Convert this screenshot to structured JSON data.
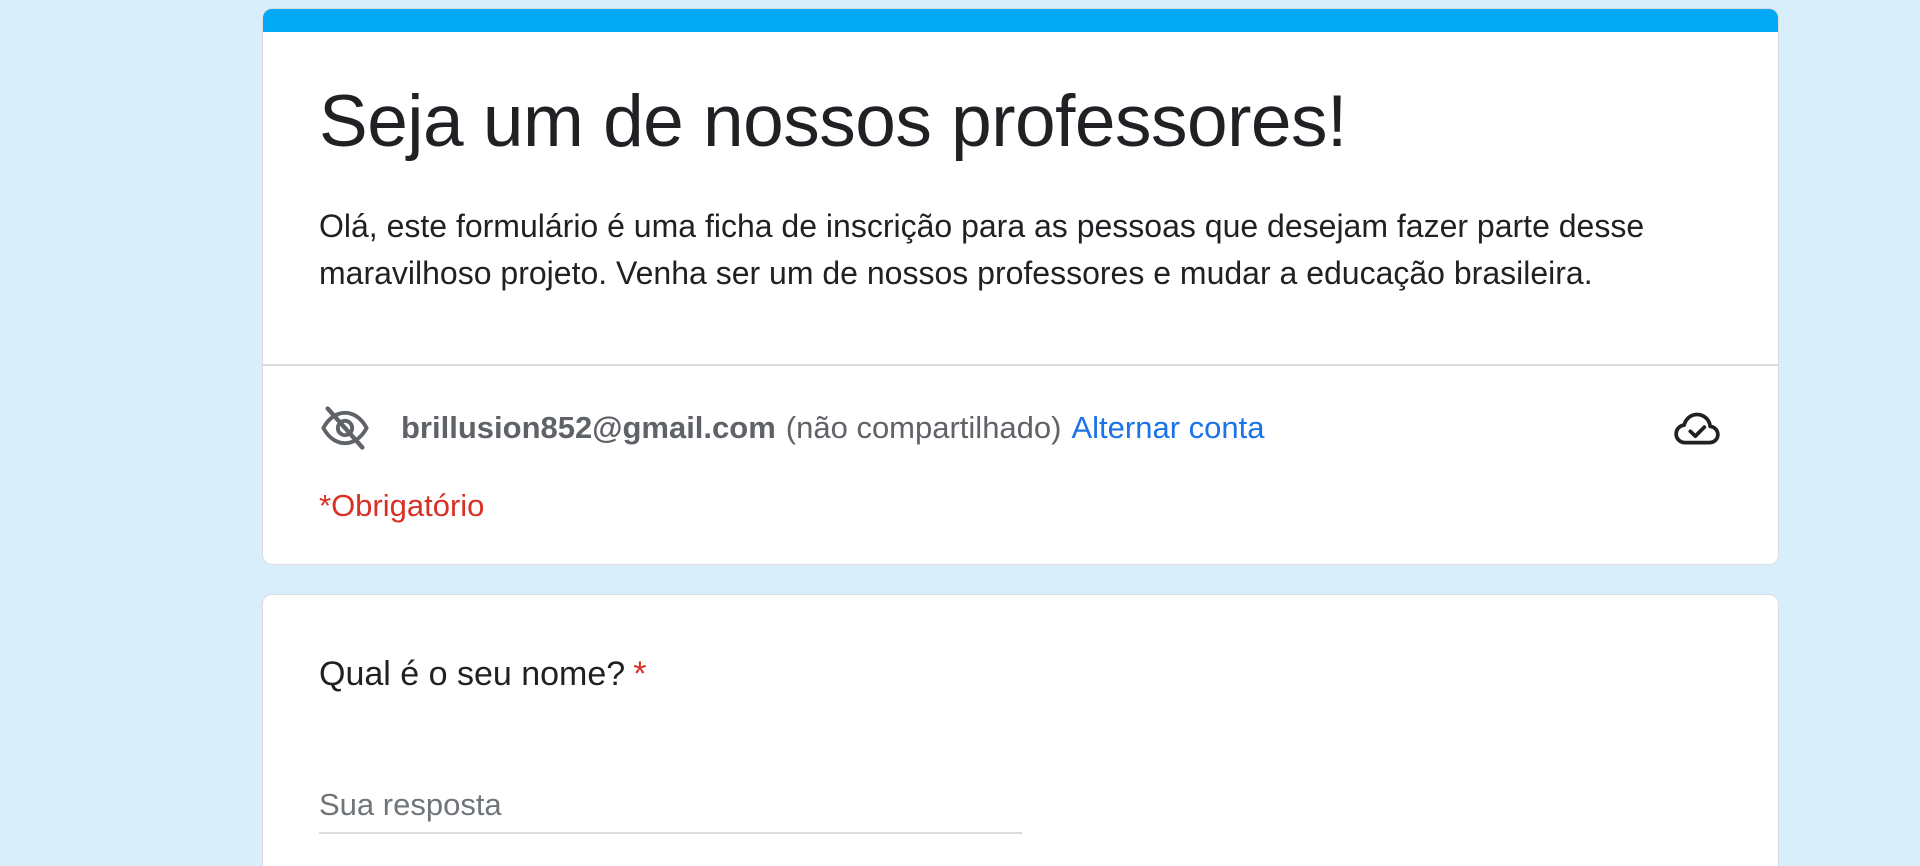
{
  "colors": {
    "page_background": "#d9eefb",
    "accent": "#03a9f4",
    "link": "#1a73e8",
    "required": "#d93025"
  },
  "header": {
    "title": "Seja um de nossos professores!",
    "description": "Olá, este formulário é uma ficha de inscrição para as pessoas que desejam fazer parte desse maravilhoso projeto. Venha ser um de nossos professores e mudar a educação brasileira."
  },
  "account": {
    "icon": "eye-off-icon",
    "email": "brillusion852@gmail.com",
    "note": "(não compartilhado)",
    "switch_label": "Alternar conta",
    "status_icon": "cloud-check-icon"
  },
  "required_note": "*Obrigatório",
  "questions": [
    {
      "label": "Qual é o seu nome?",
      "required_mark": "*",
      "placeholder": "Sua resposta"
    }
  ]
}
